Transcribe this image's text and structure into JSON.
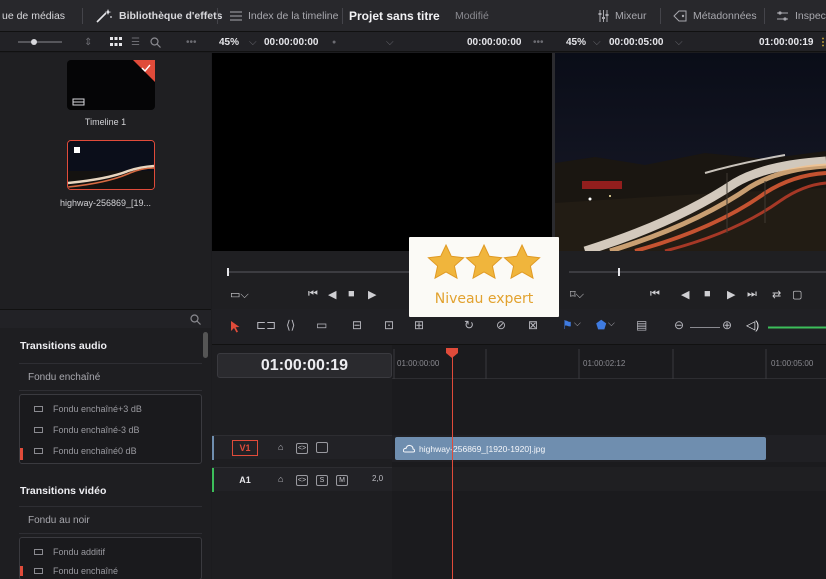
{
  "topbar": {
    "media_pool_tab": "ue de médias",
    "effects_library_tab": "Bibliothèque d'effets",
    "timeline_index_tab": "Index de la timeline",
    "project_title": "Projet sans titre",
    "modified_label": "Modifié",
    "mixer_tab": "Mixeur",
    "metadata_tab": "Métadonnées",
    "inspector_tab": "Inspect"
  },
  "source_viewer": {
    "zoom": "45%",
    "timecode": "00:00:00:00",
    "duration": "00:00:00:00"
  },
  "program_viewer": {
    "zoom": "45%",
    "timecode": "00:00:05:00",
    "current_timecode": "01:00:00:19"
  },
  "media_pool": {
    "items": [
      {
        "label": "Timeline 1"
      },
      {
        "label": "highway-256869_[19..."
      }
    ]
  },
  "effects": {
    "audio_transitions": "Transitions audio",
    "audio_group": "Fondu enchaîné",
    "audio_items": [
      "Fondu enchaîné+3 dB",
      "Fondu enchaîné-3 dB",
      "Fondu enchaîné0 dB"
    ],
    "video_transitions": "Transitions vidéo",
    "video_group": "Fondu au noir",
    "video_items": [
      "Fondu additif",
      "Fondu enchaîné"
    ]
  },
  "timeline": {
    "timecode": "01:00:00:19",
    "ruler": [
      "01:00:00:00",
      "01:00:02:12",
      "01:00:05:00"
    ],
    "video_track": {
      "name": "V1"
    },
    "audio_track": {
      "name": "A1",
      "level": "2,0",
      "solo": "S",
      "mute": "M"
    },
    "clip_name": "highway-256869_[1920-1920].jpg"
  },
  "badge": {
    "level": "Niveau expert",
    "stars": 3
  },
  "colors": {
    "accent_red": "#e04b3a",
    "clip_blue": "#6f8eaf",
    "star_gold": "#f0b53c"
  }
}
